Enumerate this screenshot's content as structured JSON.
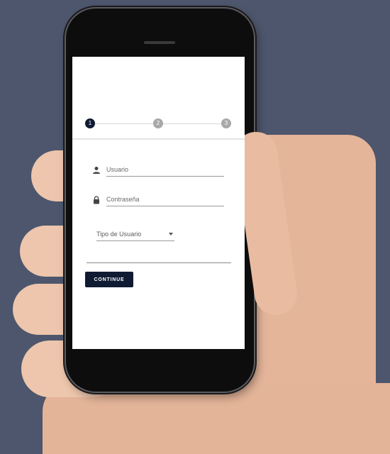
{
  "stepper": {
    "steps": [
      "1",
      "2",
      "3"
    ],
    "active_step": 1
  },
  "form": {
    "username_placeholder": "Usuario",
    "password_placeholder": "Contraseña",
    "user_type_label": "Tipo de Usuario"
  },
  "actions": {
    "continue_label": "CONTINUE"
  },
  "colors": {
    "background": "#4d566c",
    "primary": "#0f1a33",
    "step_inactive": "#a8a8a8"
  },
  "icons": {
    "username": "person-icon",
    "password": "lock-icon",
    "dropdown": "caret-down-icon"
  }
}
